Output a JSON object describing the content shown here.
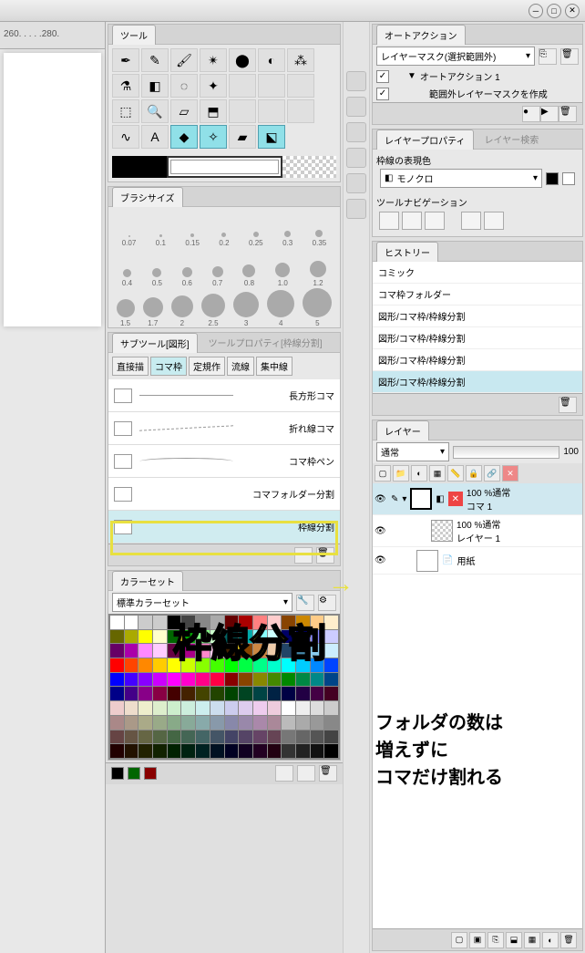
{
  "ruler": "260. . . . .280.",
  "panels": {
    "tool": "ツール",
    "brush": "ブラシサイズ",
    "subtool": "サブツール[図形]",
    "subtool_inactive": "ツールプロパティ[枠線分割]",
    "colorset": "カラーセット",
    "colorset_select": "標準カラーセット",
    "auto_action": "オートアクション",
    "auto_action_select": "レイヤーマスク(選択範囲外)",
    "auto_action_1": "オートアクション 1",
    "auto_action_item": "範囲外レイヤーマスクを作成",
    "layer_prop": "レイヤープロパティ",
    "layer_search": "レイヤー検索",
    "border_color": "枠線の表現色",
    "monochrome": "モノクロ",
    "tool_nav": "ツールナビゲーション",
    "history": "ヒストリー",
    "layer": "レイヤー"
  },
  "brushes": [
    {
      "s": 2,
      "l": "0.07"
    },
    {
      "s": 3,
      "l": "0.1"
    },
    {
      "s": 4,
      "l": "0.15"
    },
    {
      "s": 5,
      "l": "0.2"
    },
    {
      "s": 6,
      "l": "0.25"
    },
    {
      "s": 7,
      "l": "0.3"
    },
    {
      "s": 8,
      "l": "0.35"
    }
  ],
  "brushes2": [
    {
      "s": 9,
      "l": "0.4"
    },
    {
      "s": 10,
      "l": "0.5"
    },
    {
      "s": 11,
      "l": "0.6"
    },
    {
      "s": 12,
      "l": "0.7"
    },
    {
      "s": 14,
      "l": "0.8"
    },
    {
      "s": 16,
      "l": "1.0"
    },
    {
      "s": 18,
      "l": "1.2"
    }
  ],
  "brushes3": [
    {
      "s": 20,
      "l": "1.5"
    },
    {
      "s": 22,
      "l": "1.7"
    },
    {
      "s": 24,
      "l": "2"
    },
    {
      "s": 26,
      "l": "2.5"
    },
    {
      "s": 28,
      "l": "3"
    },
    {
      "s": 30,
      "l": "4"
    },
    {
      "s": 32,
      "l": "5"
    }
  ],
  "subtool_tabs": {
    "direct": "直接描",
    "frame": "コマ枠",
    "ruler": "定規作",
    "stream": "流線",
    "focus": "集中線"
  },
  "subtool_items": [
    {
      "name": "長方形コマ"
    },
    {
      "name": "折れ線コマ"
    },
    {
      "name": "コマ枠ペン"
    },
    {
      "name": "コマフォルダー分割"
    },
    {
      "name": "枠線分割"
    }
  ],
  "history_items": [
    "コミック",
    "コマ枠フォルダー",
    "図形/コマ枠/枠線分割",
    "図形/コマ枠/枠線分割",
    "図形/コマ枠/枠線分割",
    "図形/コマ枠/枠線分割"
  ],
  "layer_blend": "通常",
  "layer_opacity": "100",
  "layers": [
    {
      "name": "コマ 1",
      "info": "100 %通常"
    },
    {
      "name": "レイヤー 1",
      "info": "100 %通常"
    },
    {
      "name": "用紙",
      "info": ""
    }
  ],
  "annotations": {
    "big": "枠線分割",
    "arrow": "→",
    "note_l1": "フォルダの数は",
    "note_l2": "増えずに",
    "note_l3": "コマだけ割れる"
  },
  "swatch_colors": [
    "#fff",
    "#fff",
    "#ccc",
    "#ccc",
    "#000",
    "#444",
    "#888",
    "#aaa",
    "#600",
    "#a00",
    "#ff8080",
    "#fcc",
    "#840",
    "#c80",
    "#fc8",
    "#fec",
    "#660",
    "#aa0",
    "#ff0",
    "#ffc",
    "#060",
    "#0a0",
    "#8f8",
    "#cfc",
    "#066",
    "#0aa",
    "#8ff",
    "#cff",
    "#006",
    "#00a",
    "#88f",
    "#ccf",
    "#606",
    "#a0a",
    "#f8f",
    "#fcf",
    "#604",
    "#a08",
    "#f8c",
    "#fce",
    "#420",
    "#840",
    "#c84",
    "#eca",
    "#246",
    "#48a",
    "#8ce",
    "#cef",
    "#f00",
    "#f40",
    "#f80",
    "#fc0",
    "#ff0",
    "#cf0",
    "#8f0",
    "#4f0",
    "#0f0",
    "#0f4",
    "#0f8",
    "#0fc",
    "#0ff",
    "#0cf",
    "#08f",
    "#04f",
    "#00f",
    "#40f",
    "#80f",
    "#c0f",
    "#f0f",
    "#f0c",
    "#f08",
    "#f04",
    "#800",
    "#840",
    "#880",
    "#480",
    "#080",
    "#084",
    "#088",
    "#048",
    "#008",
    "#408",
    "#808",
    "#804",
    "#400",
    "#420",
    "#440",
    "#240",
    "#040",
    "#042",
    "#044",
    "#024",
    "#004",
    "#204",
    "#404",
    "#402",
    "#ecc",
    "#edc",
    "#eec",
    "#dec",
    "#cec",
    "#ced",
    "#cee",
    "#cde",
    "#cce",
    "#dce",
    "#ece",
    "#ecd",
    "#fff",
    "#eee",
    "#ddd",
    "#ccc",
    "#a88",
    "#a98",
    "#aa8",
    "#9a8",
    "#8a8",
    "#8a9",
    "#8aa",
    "#89a",
    "#88a",
    "#98a",
    "#a8a",
    "#a89",
    "#bbb",
    "#aaa",
    "#999",
    "#888",
    "#644",
    "#654",
    "#664",
    "#564",
    "#464",
    "#465",
    "#466",
    "#456",
    "#446",
    "#546",
    "#646",
    "#645",
    "#777",
    "#666",
    "#555",
    "#444",
    "#200",
    "#210",
    "#220",
    "#120",
    "#020",
    "#021",
    "#022",
    "#012",
    "#002",
    "#102",
    "#202",
    "#201",
    "#333",
    "#222",
    "#111",
    "#000"
  ]
}
